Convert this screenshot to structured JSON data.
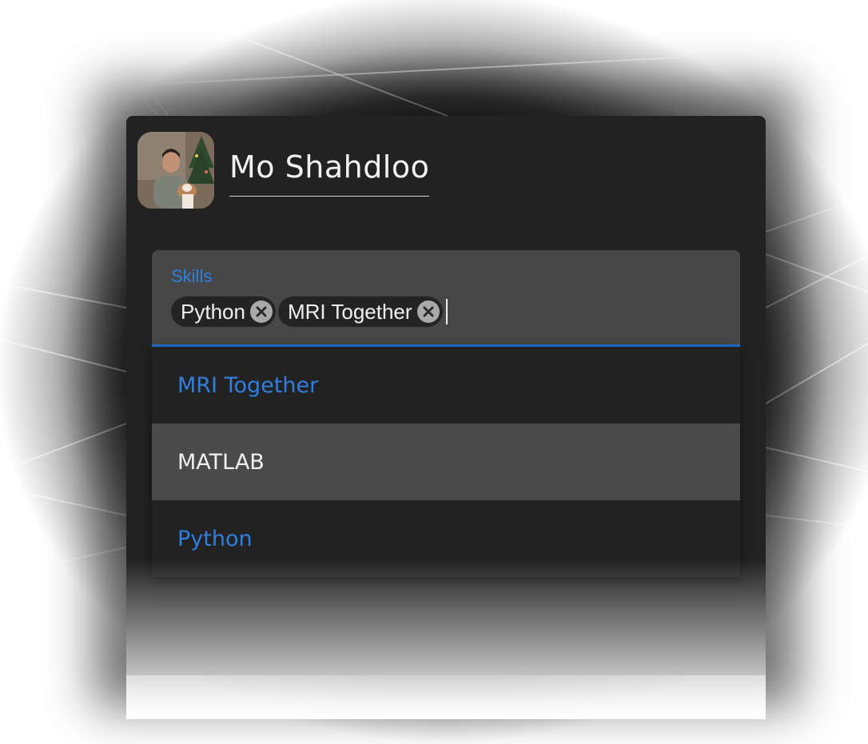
{
  "profile": {
    "name": "Mo Shahdloo",
    "avatar_icon": "profile-photo"
  },
  "skills_field": {
    "label": "Skills",
    "chips": [
      {
        "label": "Python"
      },
      {
        "label": "MRI Together"
      }
    ],
    "accent_color": "#1f6fd1"
  },
  "dropdown": {
    "options": [
      {
        "label": "MRI Together",
        "state": "selected"
      },
      {
        "label": "MATLAB",
        "state": "highlighted"
      },
      {
        "label": "Python",
        "state": "selected"
      }
    ]
  }
}
